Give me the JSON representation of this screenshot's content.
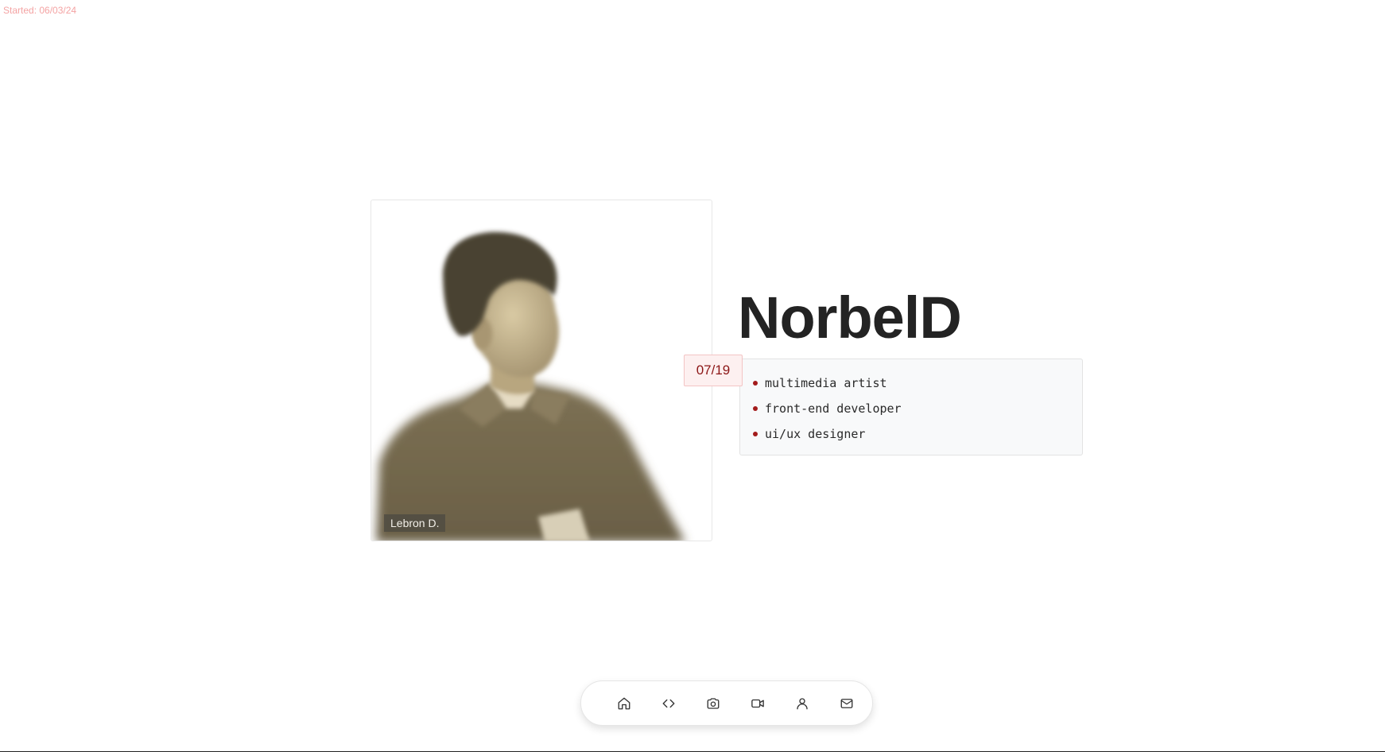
{
  "header": {
    "started_label": "Started: 06/03/24"
  },
  "profile": {
    "name": "NorbelD",
    "photo_caption": "Lebron D.",
    "date_badge": "07/19",
    "roles": [
      "multimedia artist",
      "front-end developer",
      "ui/ux designer"
    ]
  },
  "dock": {
    "items": [
      {
        "icon": "home-icon"
      },
      {
        "icon": "code-icon"
      },
      {
        "icon": "camera-icon"
      },
      {
        "icon": "video-icon"
      },
      {
        "icon": "user-icon"
      },
      {
        "icon": "mail-icon"
      }
    ]
  },
  "colors": {
    "accent": "#a31b1b",
    "badge_bg": "#fdf0f0",
    "started_text": "#f4a3a3",
    "title_text": "#232323"
  }
}
